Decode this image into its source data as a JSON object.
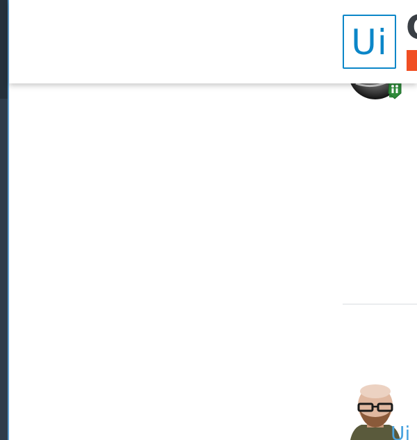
{
  "header": {
    "logo_mark": "Ui",
    "logo_word": "C"
  },
  "posts": [
    {
      "avatar": "user-avatar-dark",
      "badge_icon": "community-badge-icon"
    },
    {
      "avatar": "user-avatar-bald-glasses",
      "badge_text": "Ui"
    }
  ],
  "colors": {
    "brand_blue": "#0b86c8",
    "brand_orange": "#f04e23",
    "sidebar_dark": "#2f3d4b",
    "badge_green": "#2e8b3a"
  }
}
